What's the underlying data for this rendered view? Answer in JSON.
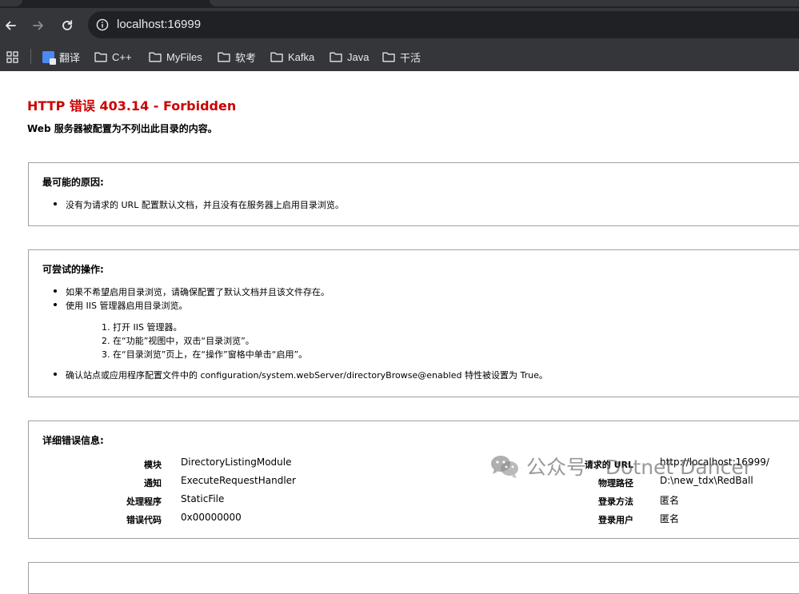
{
  "browser": {
    "address": "localhost:16999",
    "bookmarks": [
      "翻译",
      "C++",
      "MyFiles",
      "软考",
      "Kafka",
      "Java",
      "干活"
    ]
  },
  "page": {
    "title": "HTTP 错误 403.14 - Forbidden",
    "subtitle": "Web 服务器被配置为不列出此目录的内容。",
    "cause": {
      "heading": "最可能的原因:",
      "items": [
        "没有为请求的 URL 配置默认文档，并且没有在服务器上启用目录浏览。"
      ]
    },
    "actions": {
      "heading": "可尝试的操作:",
      "items": [
        "如果不希望启用目录浏览，请确保配置了默认文档并且该文件存在。",
        "使用 IIS 管理器启用目录浏览。"
      ],
      "steps": [
        "1. 打开 IIS 管理器。",
        "2. 在“功能”视图中，双击“目录浏览”。",
        "3. 在“目录浏览”页上，在“操作”窗格中单击“启用”。"
      ],
      "last_item": "确认站点或应用程序配置文件中的 configuration/system.webServer/directoryBrowse@enabled 特性被设置为 True。"
    },
    "details": {
      "heading": "详细错误信息:",
      "left": [
        {
          "label": "模块",
          "value": "DirectoryListingModule"
        },
        {
          "label": "通知",
          "value": "ExecuteRequestHandler"
        },
        {
          "label": "处理程序",
          "value": "StaticFile"
        },
        {
          "label": "错误代码",
          "value": "0x00000000"
        }
      ],
      "right": [
        {
          "label": "请求的 URL",
          "value": "http://localhost:16999/"
        },
        {
          "label": "物理路径",
          "value": "D:\\new_tdx\\RedBall"
        },
        {
          "label": "登录方法",
          "value": "匿名"
        },
        {
          "label": "登录用户",
          "value": "匿名"
        }
      ]
    }
  },
  "watermark": "公众号 · Dotnet Dancer"
}
